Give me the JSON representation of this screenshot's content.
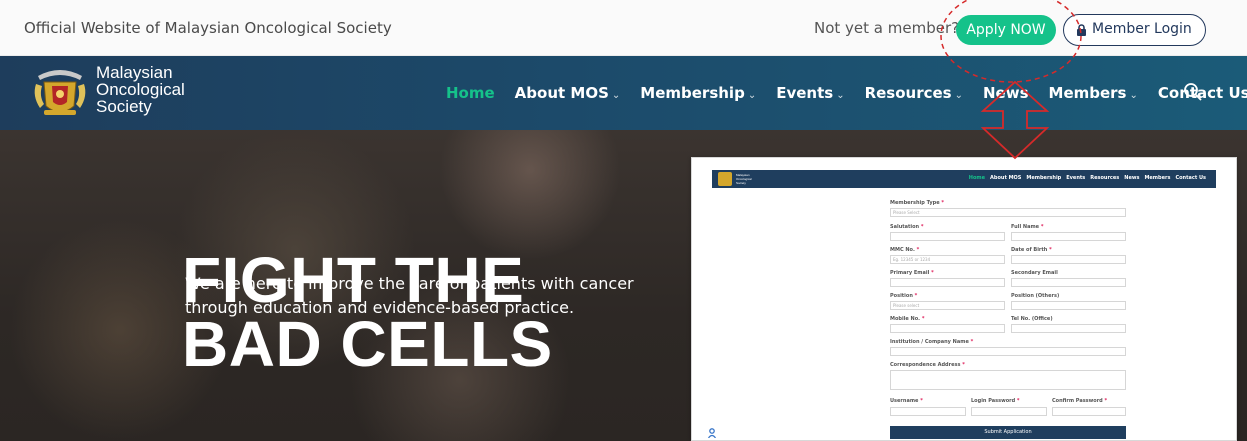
{
  "topbar": {
    "tagline": "Official Website of Malaysian Oncological Society",
    "not_member": "Not yet a member?",
    "apply_label": "Apply NOW",
    "login_label": "Member Login"
  },
  "header": {
    "logo_lines": [
      "Malaysian",
      "Oncological",
      "Society"
    ],
    "nav": [
      {
        "label": "Home",
        "active": true
      },
      {
        "label": "About MOS",
        "caret": "⌄"
      },
      {
        "label": "Membership",
        "caret": "⌄"
      },
      {
        "label": "Events",
        "caret": "⌄"
      },
      {
        "label": "Resources",
        "caret": "⌄"
      },
      {
        "label": "News"
      },
      {
        "label": "Members",
        "caret": "⌄"
      },
      {
        "label": "Contact Us"
      }
    ]
  },
  "hero": {
    "title_lines": [
      "FIGHT THE",
      "BAD CELLS"
    ],
    "subtitle": "We are here to improve the care of patients with cancer through education and evidence-based practice."
  },
  "inset": {
    "logo_lines": [
      "Malaysian",
      "Oncological",
      "Society"
    ],
    "nav": [
      "Home",
      "About MOS",
      "Membership",
      "Events",
      "Resources",
      "News",
      "Members",
      "Contact Us"
    ],
    "form": {
      "membership_type": "Membership Type",
      "membership_placeholder": "Please Select",
      "salutation": "Salutation",
      "full_name": "Full Name",
      "mmc_no": "MMC No.",
      "mmc_placeholder": "Eg. 12345 or 1234",
      "dob": "Date of Birth",
      "primary_email": "Primary Email",
      "secondary_email": "Secondary Email",
      "position": "Position",
      "position_placeholder": "Please select",
      "position_others": "Position (Others)",
      "mobile_no": "Mobile No.",
      "tel_office": "Tel No. (Office)",
      "institution": "Institution / Company Name",
      "correspondence": "Correspondence Address",
      "username": "Username",
      "login_password": "Login Password",
      "confirm_password": "Confirm Password",
      "submit": "Submit Application"
    }
  },
  "colors": {
    "accent_green": "#15c28a",
    "navy": "#1f3e5e",
    "annotation_red": "#d62a2a"
  }
}
